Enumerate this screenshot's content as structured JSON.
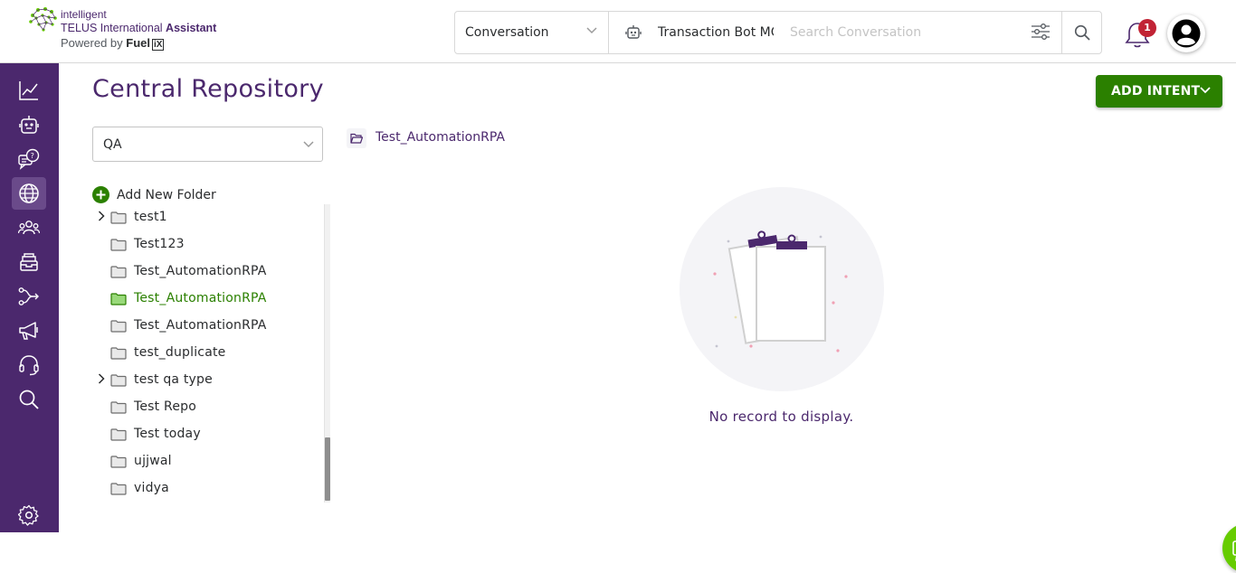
{
  "brand": {
    "line1": "intelligent",
    "line2_prefix": "TELUS International ",
    "line2_bold": "Assistant",
    "line3_prefix": "Powered by ",
    "line3_fuel": "Fuel",
    "line3_ix": "iX",
    "colors": {
      "primary": "#4b286d",
      "accent_green": "#2b8000",
      "fab_green": "#66cc00"
    }
  },
  "header": {
    "search_scope": "Conversation",
    "bot_name": "Transaction Bot MC",
    "search_placeholder": "Search Conversation",
    "notification_count": "1"
  },
  "sidebar": {
    "items": [
      {
        "icon": "analytics-chart-icon"
      },
      {
        "icon": "bot-icon"
      },
      {
        "icon": "faq-chat-icon"
      },
      {
        "icon": "globe-icon",
        "active": true
      },
      {
        "icon": "users-icon"
      },
      {
        "icon": "inbox-archive-icon"
      },
      {
        "icon": "flow-branch-icon"
      },
      {
        "icon": "megaphone-icon"
      },
      {
        "icon": "headset-icon"
      },
      {
        "icon": "search-icon"
      },
      {
        "icon": "settings-gear-icon"
      }
    ]
  },
  "main": {
    "title": "Central Repository",
    "add_intent_label": "ADD INTENT",
    "repo_selected": "QA",
    "add_folder_label": "Add New Folder",
    "folders": [
      {
        "name": "test1",
        "expandable": true,
        "selected": false
      },
      {
        "name": "Test123",
        "expandable": false,
        "selected": false
      },
      {
        "name": "Test_AutomationRPA",
        "expandable": false,
        "selected": false
      },
      {
        "name": "Test_AutomationRPA",
        "expandable": false,
        "selected": true
      },
      {
        "name": "Test_AutomationRPA",
        "expandable": false,
        "selected": false
      },
      {
        "name": "test_duplicate",
        "expandable": false,
        "selected": false
      },
      {
        "name": "test qa type",
        "expandable": true,
        "selected": false
      },
      {
        "name": "Test Repo",
        "expandable": false,
        "selected": false
      },
      {
        "name": "Test today",
        "expandable": false,
        "selected": false
      },
      {
        "name": "ujjwal",
        "expandable": false,
        "selected": false
      },
      {
        "name": "vidya",
        "expandable": false,
        "selected": false
      }
    ],
    "breadcrumb": "Test_AutomationRPA",
    "empty_message": "No record to display."
  }
}
